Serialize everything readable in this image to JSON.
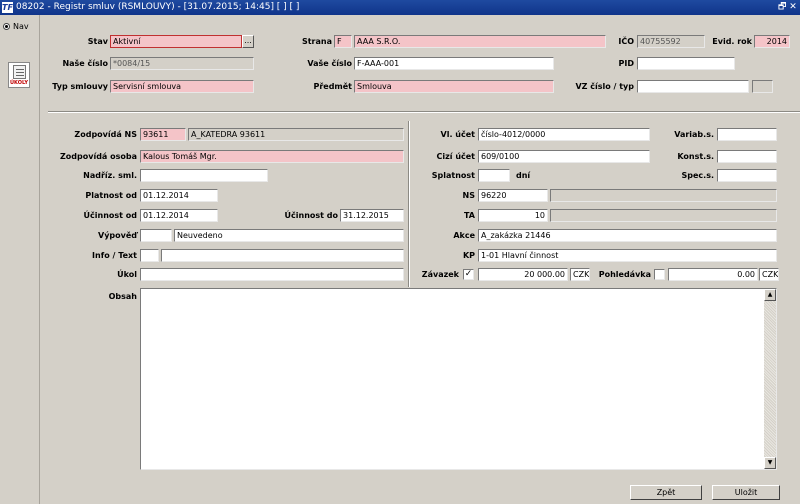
{
  "window": {
    "title": "08202 - Registr smluv (RSMLOUVY) - [31.07.2015; 14:45] [ ] [ ]",
    "app_icon": "TF",
    "restore_glyph": "🗗",
    "close_glyph": "✕"
  },
  "left_nav": {
    "nav_label": "Nav",
    "ukol_caption": "ÚKOLY"
  },
  "header": {
    "stav_label": "Stav",
    "stav_value": "Aktivní",
    "stav_button": "...",
    "strana_label": "Strana",
    "strana_code": "F",
    "strana_value": "AAA S.R.O.",
    "ico_label": "IČO",
    "ico_value": "40755592",
    "evid_label": "Evid. rok",
    "evid_value": "2014",
    "nase_label": "Naše číslo",
    "nase_value": "*0084/15",
    "vase_label": "Vaše číslo",
    "vase_value": "F-AAA-001",
    "pid_label": "PID",
    "pid_value": "",
    "typ_label": "Typ smlouvy",
    "typ_value": "Servisní smlouva",
    "predmet_label": "Předmět",
    "predmet_value": "Smlouva",
    "vz_label": "VZ číslo / typ",
    "vz_value": "",
    "vz_typ": ""
  },
  "left_form": {
    "zodp_ns_label": "Zodpovídá NS",
    "zodp_ns_code": "93611",
    "zodp_ns_name": "A_KATEDRA 93611",
    "zodp_os_label": "Zodpovídá osoba",
    "zodp_os_value": "Kalous Tomáš Mgr.",
    "nadriz_label": "Nadříz. sml.",
    "nadriz_value": "",
    "platnost_label": "Platnost od",
    "platnost_value": "01.12.2014",
    "ucinnost_od_label": "Účinnost od",
    "ucinnost_od_value": "01.12.2014",
    "ucinnost_do_label": "Účinnost do",
    "ucinnost_do_value": "31.12.2015",
    "vypoved_label": "Výpověď",
    "vypoved_code": "",
    "vypoved_value": "Neuvedeno",
    "info_label": "Info / Text",
    "info_code": "",
    "info_value": "",
    "ukol_label": "Úkol",
    "ukol_value": ""
  },
  "right_form": {
    "vl_ucet_label": "Vl. účet",
    "vl_ucet_value": "číslo-4012/0000",
    "variab_label": "Variab.s.",
    "variab_value": "",
    "cizi_label": "Cizí účet",
    "cizi_value": "609/0100",
    "konst_label": "Konst.s.",
    "konst_value": "",
    "splatnost_label": "Splatnost",
    "splatnost_value": "",
    "dni_label": "dní",
    "spec_label": "Spec.s.",
    "spec_value": "",
    "ns_label": "NS",
    "ns_value": "96220",
    "ns_desc": "",
    "ta_label": "TA",
    "ta_value": "10",
    "ta_desc": "",
    "akce_label": "Akce",
    "akce_value": "A_zakázka 21446",
    "kp_label": "KP",
    "kp_value": "1-01 Hlavní činnost",
    "zavazek_label": "Závazek",
    "zavazek_checked": "✓",
    "zavazek_amount": "20 000.00",
    "zavazek_currency": "CZK",
    "pohl_label": "Pohledávka",
    "pohl_checked": "",
    "pohl_amount": "0.00",
    "pohl_currency": "CZK"
  },
  "obsah": {
    "label": "Obsah",
    "value": "",
    "scroll_up": "▲",
    "scroll_down": "▼"
  },
  "buttons": {
    "back": "Zpět",
    "save": "Uložit"
  }
}
